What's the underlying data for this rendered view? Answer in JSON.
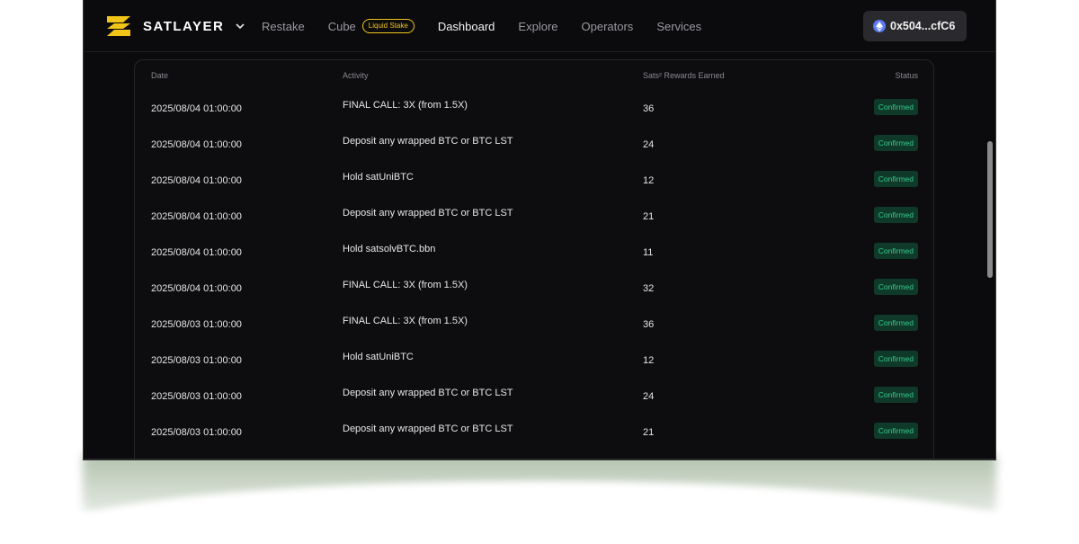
{
  "brand": {
    "name": "SATLAYER",
    "logo_icon": "satlayer-logo-icon",
    "accent": "#f0c419"
  },
  "nav": {
    "items": [
      {
        "label": "Restake"
      },
      {
        "label": "Cube",
        "badge": "Liquid Stake"
      },
      {
        "label": "Dashboard",
        "active": true
      },
      {
        "label": "Explore"
      },
      {
        "label": "Operators"
      },
      {
        "label": "Services"
      }
    ]
  },
  "wallet": {
    "address": "0x504...cfC6",
    "icon": "ethereum-icon"
  },
  "table": {
    "headers": {
      "date": "Date",
      "activity": "Activity",
      "rewards": "Sats² Rewards Earned",
      "status": "Status"
    },
    "rows": [
      {
        "date": "2025/08/04 01:00:00",
        "activity": "FINAL CALL: 3X (from 1.5X)",
        "rewards": "36",
        "status": "Confirmed"
      },
      {
        "date": "2025/08/04 01:00:00",
        "activity": "Deposit any wrapped BTC or BTC LST",
        "rewards": "24",
        "status": "Confirmed"
      },
      {
        "date": "2025/08/04 01:00:00",
        "activity": "Hold satUniBTC",
        "rewards": "12",
        "status": "Confirmed"
      },
      {
        "date": "2025/08/04 01:00:00",
        "activity": "Deposit any wrapped BTC or BTC LST",
        "rewards": "21",
        "status": "Confirmed"
      },
      {
        "date": "2025/08/04 01:00:00",
        "activity": "Hold satsolvBTC.bbn",
        "rewards": "11",
        "status": "Confirmed"
      },
      {
        "date": "2025/08/04 01:00:00",
        "activity": "FINAL CALL: 3X (from 1.5X)",
        "rewards": "32",
        "status": "Confirmed"
      },
      {
        "date": "2025/08/03 01:00:00",
        "activity": "FINAL CALL: 3X (from 1.5X)",
        "rewards": "36",
        "status": "Confirmed"
      },
      {
        "date": "2025/08/03 01:00:00",
        "activity": "Hold satUniBTC",
        "rewards": "12",
        "status": "Confirmed"
      },
      {
        "date": "2025/08/03 01:00:00",
        "activity": "Deposit any wrapped BTC or BTC LST",
        "rewards": "24",
        "status": "Confirmed"
      },
      {
        "date": "2025/08/03 01:00:00",
        "activity": "Deposit any wrapped BTC or BTC LST",
        "rewards": "21",
        "status": "Confirmed"
      }
    ]
  },
  "colors": {
    "background": "#0b0b0d",
    "status_bg": "#0f3a2a",
    "status_text": "#36c98a"
  }
}
